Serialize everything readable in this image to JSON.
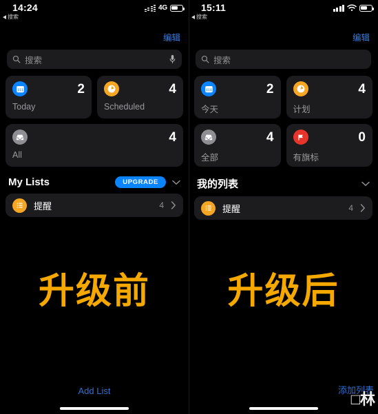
{
  "left": {
    "status": {
      "time": "14:24",
      "back_label": "搜索",
      "network": "4G",
      "signal_icon": "signal-bars-dotted-icon",
      "battery_icon": "battery-icon"
    },
    "edit_label": "编辑",
    "search": {
      "placeholder": "搜索",
      "search_icon": "search-icon",
      "mic_icon": "microphone-icon"
    },
    "smart_cards": [
      {
        "label": "Today",
        "count": "2",
        "icon": "calendar-icon",
        "color": "#0a84ff"
      },
      {
        "label": "Scheduled",
        "count": "4",
        "icon": "clock-icon",
        "color": "#f5a623"
      },
      {
        "label": "All",
        "count": "4",
        "icon": "inbox-icon",
        "color": "#8e8e93"
      }
    ],
    "my_lists": {
      "title": "My Lists",
      "upgrade_label": "UPGRADE",
      "chevron_icon": "chevron-down-icon",
      "items": [
        {
          "name": "提醒",
          "count": "4",
          "icon": "list-bullet-icon",
          "color": "#f5a623"
        }
      ]
    },
    "caption": "升级前",
    "add_list_label": "Add List"
  },
  "right": {
    "status": {
      "time": "15:11",
      "back_label": "搜索",
      "signal_icon": "signal-bars-icon",
      "wifi_icon": "wifi-icon",
      "battery_icon": "battery-icon"
    },
    "edit_label": "编辑",
    "search": {
      "placeholder": "搜索",
      "search_icon": "search-icon"
    },
    "smart_cards": [
      {
        "label": "今天",
        "count": "2",
        "icon": "calendar-icon",
        "color": "#0a84ff"
      },
      {
        "label": "计划",
        "count": "4",
        "icon": "clock-icon",
        "color": "#f5a623"
      },
      {
        "label": "全部",
        "count": "4",
        "icon": "inbox-icon",
        "color": "#8e8e93"
      },
      {
        "label": "有旗标",
        "count": "0",
        "icon": "flag-icon",
        "color": "#e8352c"
      }
    ],
    "my_lists": {
      "title": "我的列表",
      "chevron_icon": "chevron-down-icon",
      "items": [
        {
          "name": "提醒",
          "count": "4",
          "icon": "list-bullet-icon",
          "color": "#f5a623"
        }
      ]
    },
    "caption": "升级后",
    "add_list_label": "添加列表"
  },
  "watermark": {
    "text": "□林"
  },
  "colors": {
    "background": "#000000",
    "card": "#1c1c1e",
    "accent_blue": "#0a84ff",
    "link_blue": "#3b7de0",
    "caption_yellow": "#f5a800",
    "secondary_text": "#8e8e93"
  }
}
